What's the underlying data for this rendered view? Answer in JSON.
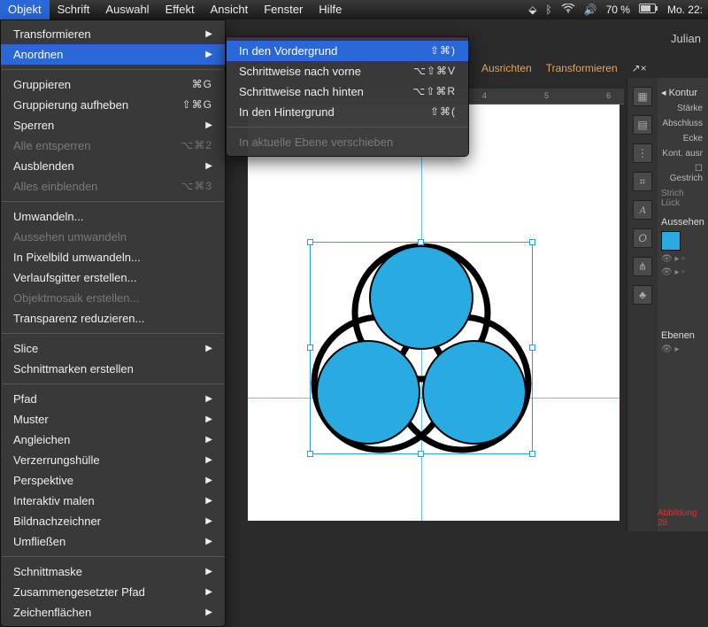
{
  "menubar": {
    "items": [
      "Objekt",
      "Schrift",
      "Auswahl",
      "Effekt",
      "Ansicht",
      "Fenster",
      "Hilfe"
    ],
    "active_index": 0,
    "status": {
      "battery": "70 %",
      "clock": "Mo. 22:"
    }
  },
  "window": {
    "user_tab": "Julian"
  },
  "panelbar": {
    "a": "Ausrichten",
    "b": "Transformieren"
  },
  "ruler": {
    "t1": "4",
    "t2": "5",
    "t3": "6"
  },
  "menu_main": [
    {
      "label": "Transformieren",
      "arrow": true
    },
    {
      "label": "Anordnen",
      "arrow": true,
      "highlight": true
    },
    {
      "sep": true
    },
    {
      "label": "Gruppieren",
      "shortcut": "⌘G"
    },
    {
      "label": "Gruppierung aufheben",
      "shortcut": "⇧⌘G"
    },
    {
      "label": "Sperren",
      "arrow": true
    },
    {
      "label": "Alle entsperren",
      "shortcut": "⌥⌘2",
      "disabled": true
    },
    {
      "label": "Ausblenden",
      "arrow": true
    },
    {
      "label": "Alles einblenden",
      "shortcut": "⌥⌘3",
      "disabled": true
    },
    {
      "sep": true
    },
    {
      "label": "Umwandeln..."
    },
    {
      "label": "Aussehen umwandeln",
      "disabled": true
    },
    {
      "label": "In Pixelbild umwandeln..."
    },
    {
      "label": "Verlaufsgitter erstellen..."
    },
    {
      "label": "Objektmosaik erstellen...",
      "disabled": true
    },
    {
      "label": "Transparenz reduzieren..."
    },
    {
      "sep": true
    },
    {
      "label": "Slice",
      "arrow": true
    },
    {
      "label": "Schnittmarken erstellen"
    },
    {
      "sep": true
    },
    {
      "label": "Pfad",
      "arrow": true
    },
    {
      "label": "Muster",
      "arrow": true
    },
    {
      "label": "Angleichen",
      "arrow": true
    },
    {
      "label": "Verzerrungshülle",
      "arrow": true
    },
    {
      "label": "Perspektive",
      "arrow": true
    },
    {
      "label": "Interaktiv malen",
      "arrow": true
    },
    {
      "label": "Bildnachzeichner",
      "arrow": true
    },
    {
      "label": "Umfließen",
      "arrow": true
    },
    {
      "sep": true
    },
    {
      "label": "Schnittmaske",
      "arrow": true
    },
    {
      "label": "Zusammengesetzter Pfad",
      "arrow": true
    },
    {
      "label": "Zeichenflächen",
      "arrow": true
    }
  ],
  "menu_sub": [
    {
      "label": "In den Vordergrund",
      "shortcut": "⇧⌘)",
      "highlight": true
    },
    {
      "label": "Schrittweise nach vorne",
      "shortcut": "⌥⇧⌘V"
    },
    {
      "label": "Schrittweise nach hinten",
      "shortcut": "⌥⇧⌘R"
    },
    {
      "label": "In den Hintergrund",
      "shortcut": "⇧⌘("
    },
    {
      "sep": true
    },
    {
      "label": "In aktuelle Ebene verschieben",
      "disabled": true
    }
  ],
  "rpanel": {
    "kontur": "Kontur",
    "staerke": "Stärke",
    "abschluss": "Abschluss",
    "ecken": "Ecke",
    "kont": "Kont. ausr",
    "gestrich": "Gestrich",
    "strich": "Strich",
    "luecke": "Lück",
    "aussehen": "Aussehen",
    "ebenen": "Ebenen",
    "abbildung": "Abbildung  28"
  },
  "artwork": {
    "fill": "#29abe2",
    "stroke": "#000000",
    "sel_color": "#2aa0e0"
  }
}
